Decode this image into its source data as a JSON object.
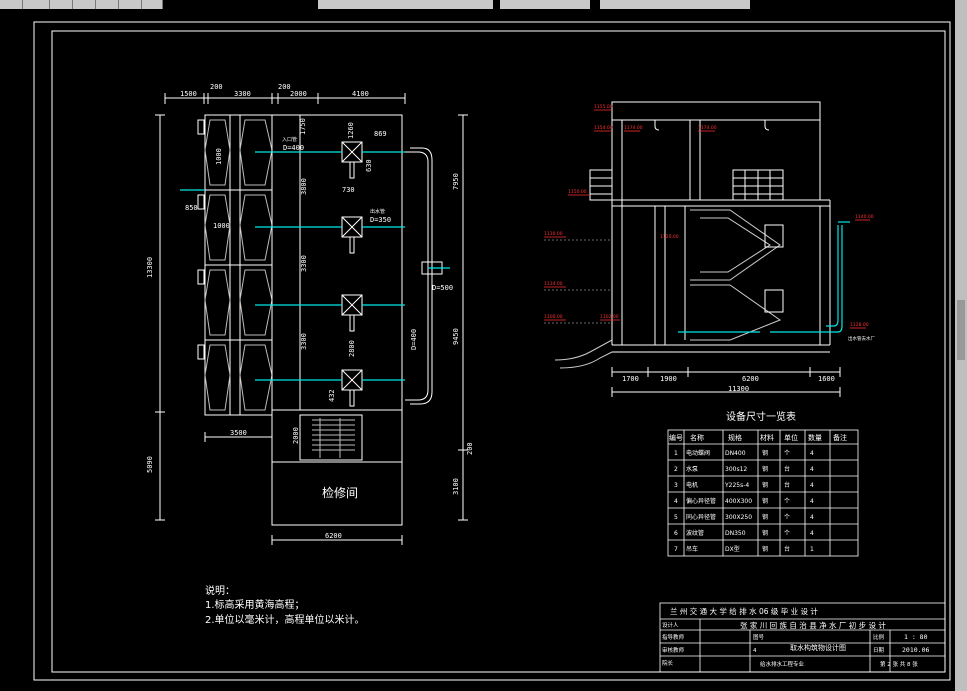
{
  "toolbar": {
    "tabs": [
      "",
      "",
      "",
      "",
      "",
      "",
      ""
    ]
  },
  "plan": {
    "dims_top": [
      "1500",
      "200",
      "3300",
      "200",
      "2000",
      "4100"
    ],
    "dim_left_main": "13300",
    "dim_left_lower": "5090",
    "dims_inner": [
      "1750",
      "1260",
      "869",
      "3800",
      "3300",
      "3300",
      "2800",
      "2000",
      "432",
      "730",
      "630",
      "1000",
      "850"
    ],
    "dim_right": [
      "7950",
      "9450",
      "3100",
      "200"
    ],
    "dims_bottom": [
      "3500",
      "6200"
    ],
    "pipe_labels": [
      "D=400",
      "D=350",
      "D=500",
      "D=400"
    ],
    "small_labels": [
      "入口管",
      "出水管"
    ],
    "room_label": "检修间"
  },
  "section": {
    "dims_bottom": [
      "1700",
      "1900",
      "6200",
      "1600",
      "11300"
    ],
    "elev_marks": [
      "1155.00",
      "1154.00",
      "1174.00",
      "1150.00",
      "1130.00",
      "1134.00",
      "1100.00",
      "1102.00",
      "1120.00",
      "1140.00",
      "1128.00"
    ],
    "outlet_label": "出水管去水厂"
  },
  "table": {
    "title": "设备尺寸一览表",
    "headers": [
      "编号",
      "名称",
      "规格",
      "材料",
      "单位",
      "数量",
      "备注"
    ],
    "rows": [
      [
        "1",
        "电动蝶阀",
        "DN400",
        "钢",
        "个",
        "4",
        ""
      ],
      [
        "2",
        "水泵",
        "300s12",
        "钢",
        "台",
        "4",
        ""
      ],
      [
        "3",
        "电机",
        "Y225s-4",
        "钢",
        "台",
        "4",
        ""
      ],
      [
        "4",
        "偏心异径管",
        "400X300",
        "钢",
        "个",
        "4",
        ""
      ],
      [
        "5",
        "同心异径管",
        "300X250",
        "钢",
        "个",
        "4",
        ""
      ],
      [
        "6",
        "波纹管",
        "DN350",
        "钢",
        "个",
        "4",
        ""
      ],
      [
        "7",
        "吊车",
        "DX型",
        "钢",
        "台",
        "1",
        ""
      ]
    ]
  },
  "notes": {
    "title": "说明：",
    "lines": [
      "1.标高采用黄海高程；",
      "2.单位以毫米计，高程单位以米计。"
    ]
  },
  "titleblock": {
    "header": "兰 州 交 通 大 学 给 排 水 06 级 毕 业 设 计",
    "project": "张 家 川 回 族 自 治 县 净 水 厂 初 步 设 计",
    "drawing": "取水构筑物设计图",
    "left_labels": [
      "设计人",
      "指导教师",
      "审核教师",
      "院长"
    ],
    "scale_label": "比例",
    "scale": "1 : 80",
    "date_label": "日期",
    "date": "2010.06",
    "sheet": "第 2 张   共 8 张",
    "major": "给水排水工程专业",
    "unit_no": "4",
    "unit_label": "图号"
  },
  "colors": {
    "line": "#ffffff",
    "pipe": "#00e5e5",
    "mark": "#ff3030",
    "text": "#ffffff",
    "bg": "#000000",
    "grey": "#9a9a9a"
  }
}
